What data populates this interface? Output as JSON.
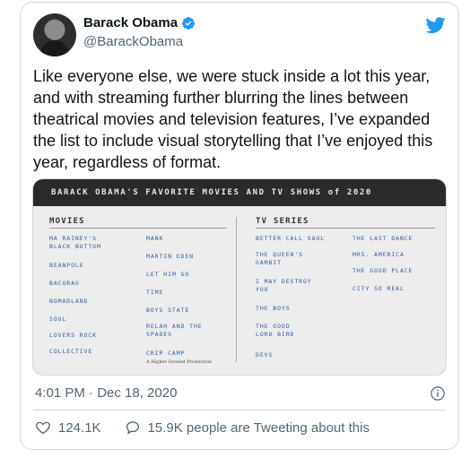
{
  "tweet": {
    "author_name": "Barack Obama",
    "author_handle": "@BarackObama",
    "text": "Like everyone else, we were stuck inside a lot this year, and with streaming further blurring the lines between theatrical movies and television features, I’ve expanded the list to include visual storytelling that I’ve enjoyed this year, regardless of format.",
    "timestamp": "4:01 PM · Dec 18, 2020",
    "likes": "124.1K",
    "tweeting_count_text": "15.9K people are Tweeting about this"
  },
  "media": {
    "header": "BARACK OBAMA'S FAVORITE MOVIES AND TV SHOWS of 2020",
    "movies_title": "MOVIES",
    "tv_title": "TV SERIES",
    "movies_col1": [
      "MA RAINEY'S\nBLACK BOTTOM",
      "BEANPOLE",
      "BACURAU",
      "NOMADLAND",
      "SOUL",
      "LOVERS ROCK",
      "COLLECTIVE"
    ],
    "movies_col2": [
      "MANK",
      "MARTIN EDEN",
      "LET HIM GO",
      "TIME",
      "BOYS STATE",
      "RELAH AND THE\nSPADES",
      "CRIP CAMP"
    ],
    "crip_camp_note": "A Higher Ground Production",
    "tv_col1": [
      "BETTER CALL SAUL",
      "THE QUEEN'S\nGAMBIT",
      "I MAY DESTROY\nYOU",
      "THE BOYS",
      "THE GOOD\nLORD BIRD",
      "DEVS"
    ],
    "tv_col2": [
      "THE LAST DANCE",
      "MRS. AMERICA",
      "THE GOOD PLACE",
      "CITY SO REAL"
    ]
  },
  "colors": {
    "verified": "#1d9bf0",
    "twitter_blue": "#1d9bf0",
    "entry": "#2f5fa4"
  },
  "icons": [
    "verified-badge-icon",
    "twitter-bird-icon",
    "info-icon",
    "heart-icon",
    "speech-bubble-icon"
  ]
}
